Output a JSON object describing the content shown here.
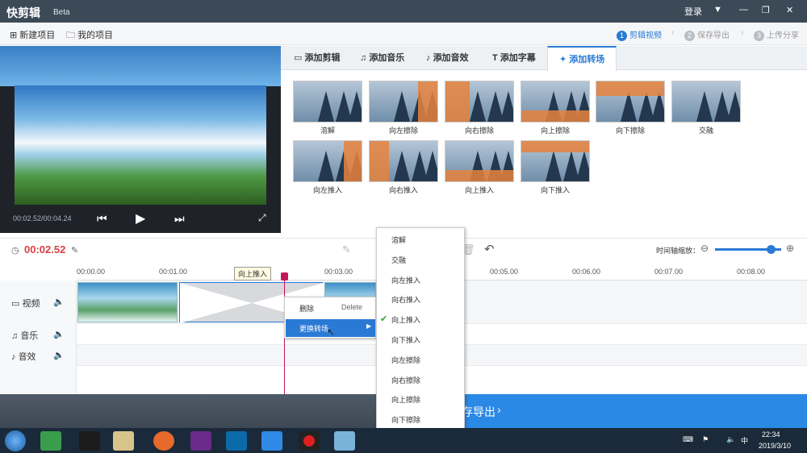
{
  "app": {
    "title": "快剪辑",
    "badge": "Beta",
    "login": "登录"
  },
  "toolbar": {
    "new_project": "新建项目",
    "my_projects": "我的项目"
  },
  "steps": [
    {
      "num": "1",
      "label": "剪辑视频"
    },
    {
      "num": "2",
      "label": "保存导出"
    },
    {
      "num": "3",
      "label": "上传分享"
    }
  ],
  "player": {
    "time": "00:02.52/00:04.24"
  },
  "tabs": [
    "添加剪辑",
    "添加音乐",
    "添加音效",
    "添加字幕",
    "添加转场"
  ],
  "transitions": [
    "溶解",
    "向左擦除",
    "向右擦除",
    "向上擦除",
    "向下擦除",
    "交融",
    "向左推入",
    "向右推入",
    "向上推入",
    "向下推入"
  ],
  "timeline": {
    "current": "00:02.52",
    "zoom_label": "时间轴缩放：",
    "tooltip": "向上推入",
    "ticks": [
      "00:00.00",
      "00:01.00",
      "00:03.00",
      "00:05.00",
      "00:06.00",
      "00:07.00",
      "00:08.00"
    ]
  },
  "tracks": [
    "视频",
    "音乐",
    "音效"
  ],
  "context_menu": {
    "delete": "删除",
    "delete_key": "Delete",
    "change": "更换转场"
  },
  "submenu": [
    "溶解",
    "交融",
    "向左推入",
    "向右推入",
    "向上推入",
    "向下推入",
    "向左擦除",
    "向右擦除",
    "向上擦除",
    "向下擦除"
  ],
  "export": {
    "label": "存导出"
  },
  "taskbar": {
    "time": "22:34",
    "date": "2019/3/10"
  },
  "colors": {
    "accent": "#2a7ad5",
    "time": "#d93f3f"
  }
}
